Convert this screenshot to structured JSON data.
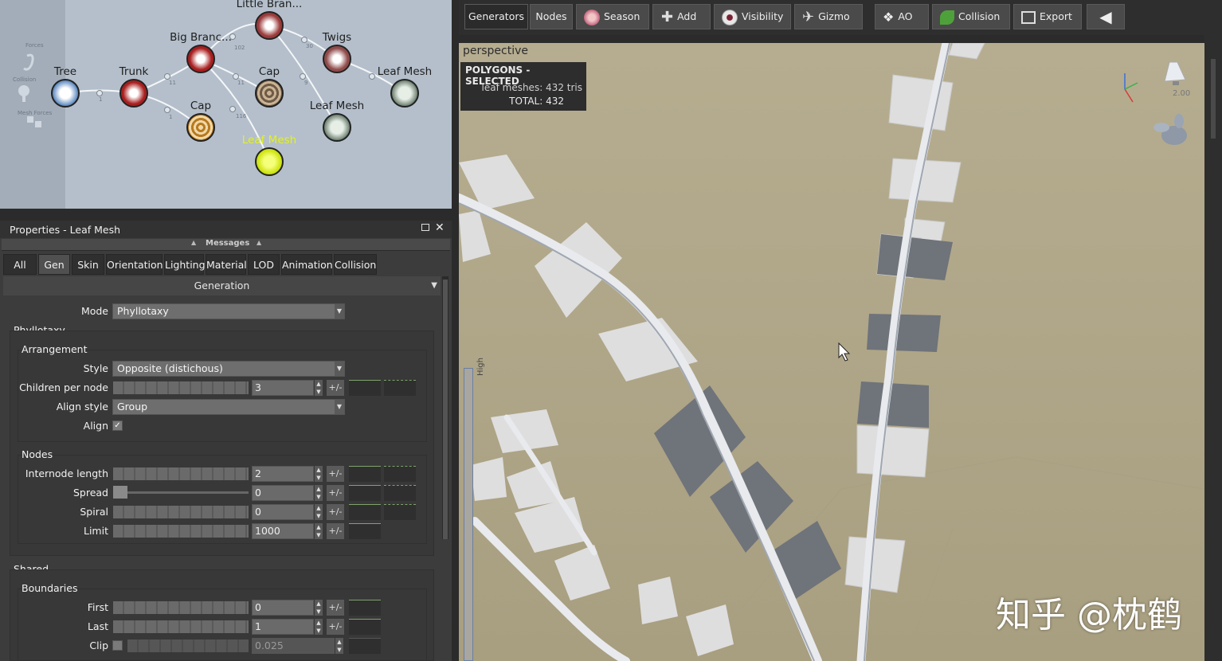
{
  "graph": {
    "nodes": [
      {
        "label": "Tree",
        "kind": "tree"
      },
      {
        "label": "Trunk",
        "kind": "branch"
      },
      {
        "label": "Big Branc...",
        "kind": "branch"
      },
      {
        "label": "Little Bran...",
        "kind": "branch"
      },
      {
        "label": "Twigs",
        "kind": "branch"
      },
      {
        "label": "Cap",
        "kind": "cap"
      },
      {
        "label": "Cap",
        "kind": "cap"
      },
      {
        "label": "Leaf Mesh",
        "kind": "leaf"
      },
      {
        "label": "Leaf Mesh",
        "kind": "leaf"
      },
      {
        "label": "Leaf Mesh",
        "kind": "leaf-selected"
      }
    ],
    "side_tools": [
      "Forces",
      "Collision",
      "Mesh Forces"
    ],
    "edge_counts": [
      "1",
      "11",
      "102",
      "11",
      "30",
      "9",
      "1",
      "116"
    ]
  },
  "properties": {
    "title": "Properties - Leaf Mesh",
    "messages_label": "Messages",
    "tabs": [
      "All",
      "Gen",
      "Skin",
      "Orientation",
      "Lighting",
      "Material",
      "LOD",
      "Animation",
      "Collision"
    ],
    "active_tab": "Gen",
    "section": "Generation",
    "mode_label": "Mode",
    "mode_value": "Phyllotaxy",
    "phyllotaxy_label": "Phyllotaxy",
    "arrangement": {
      "title": "Arrangement",
      "style_label": "Style",
      "style_value": "Opposite (distichous)",
      "children_label": "Children per node",
      "children_value": "3",
      "align_style_label": "Align style",
      "align_style_value": "Group",
      "align_label": "Align",
      "align_checked": true
    },
    "nodes": {
      "title": "Nodes",
      "internode_label": "Internode length",
      "internode_value": "2",
      "spread_label": "Spread",
      "spread_value": "0",
      "spiral_label": "Spiral",
      "spiral_value": "0",
      "limit_label": "Limit",
      "limit_value": "1000"
    },
    "shared_label": "Shared",
    "boundaries": {
      "title": "Boundaries",
      "first_label": "First",
      "first_value": "0",
      "last_label": "Last",
      "last_value": "1",
      "clip_label": "Clip",
      "clip_value": "0.025"
    },
    "pm_label": "+/-"
  },
  "toolbar": {
    "buttons": [
      "Generators",
      "Nodes",
      "Season",
      "Add",
      "Visibility",
      "Gizmo",
      "AO",
      "Collision",
      "Export"
    ]
  },
  "viewport": {
    "view_name": "perspective",
    "stats_title": "POLYGONS - SELECTED",
    "stats_line1": "leaf meshes: 432 tris",
    "stats_line2": "TOTAL: 432",
    "light_value": "2.00",
    "ruler_label": "High",
    "watermark": "知乎 @枕鹤"
  },
  "colors": {
    "graph_bg": "#b4bfcb",
    "viewport_bg": "#b3a98c",
    "selected_leaf": "#d8ee18",
    "panel_bg": "#3c3c3c"
  }
}
